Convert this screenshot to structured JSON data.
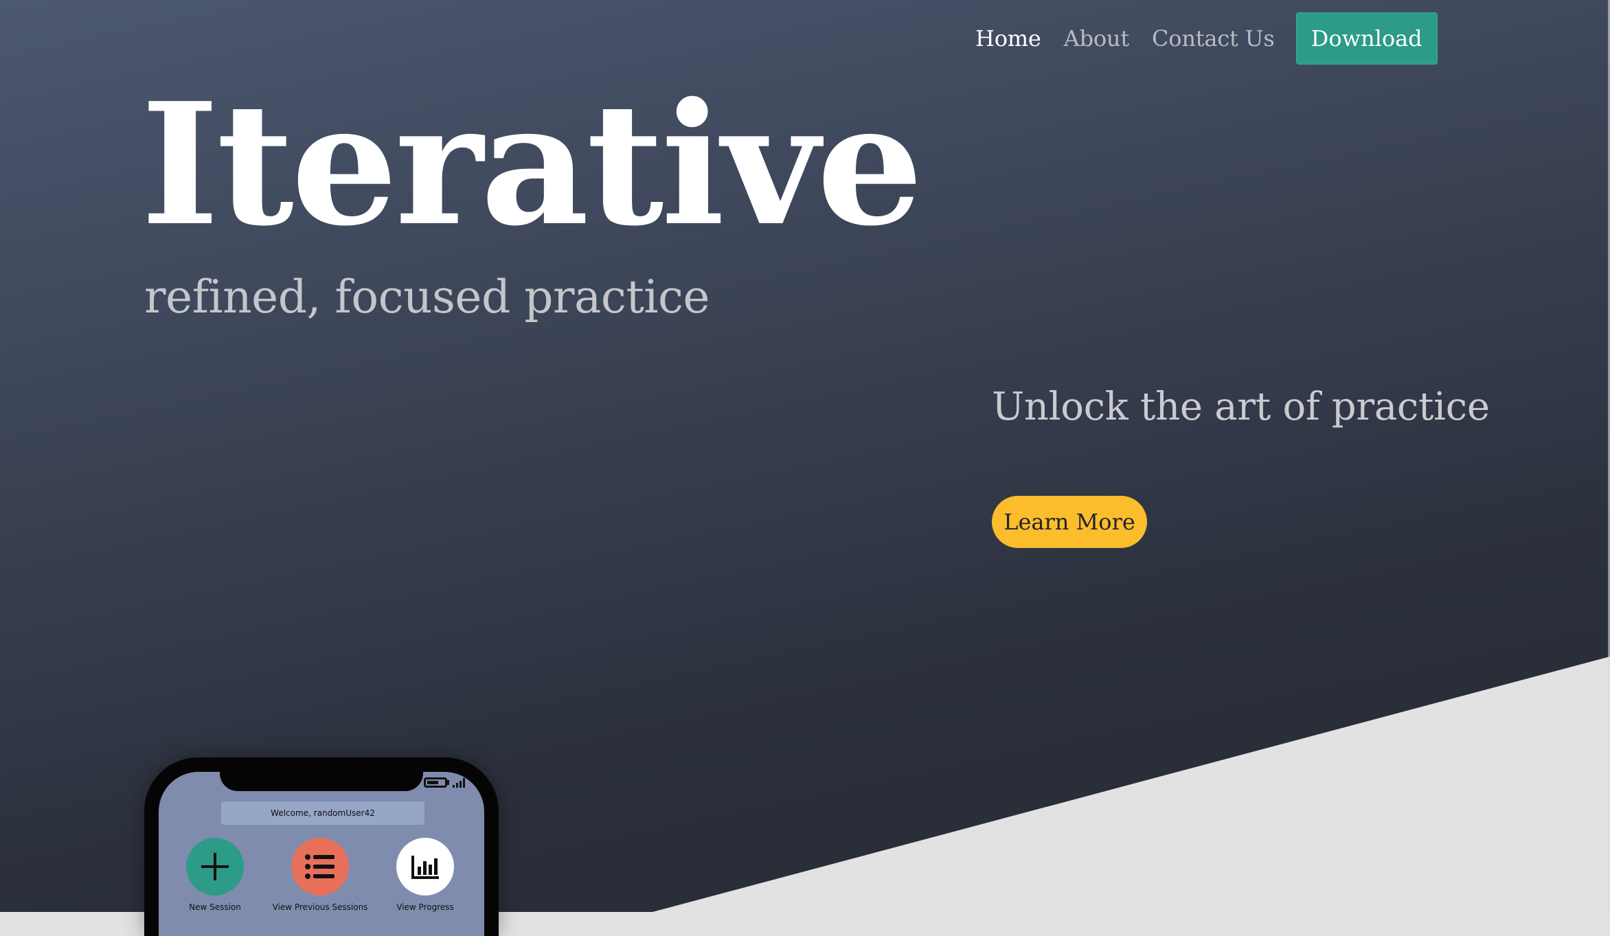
{
  "nav": {
    "home": "Home",
    "about": "About",
    "contact": "Contact Us",
    "download": "Download"
  },
  "hero": {
    "title": "Iterative",
    "subtitle": "refined, focused practice",
    "tagline": "Unlock the art of practice",
    "learn_more": "Learn More"
  },
  "phone": {
    "welcome": "Welcome, randomUser42",
    "actions": [
      {
        "label": "New Session",
        "icon": "plus-icon",
        "color": "#2c9b87"
      },
      {
        "label": "View Previous Sessions",
        "icon": "list-icon",
        "color": "#e8705a"
      },
      {
        "label": "View Progress",
        "icon": "bar-chart-icon",
        "color": "#ffffff"
      }
    ]
  },
  "colors": {
    "accent": "#2c9b87",
    "cta": "#fbbd2b",
    "background_dark": "#2b303c"
  }
}
